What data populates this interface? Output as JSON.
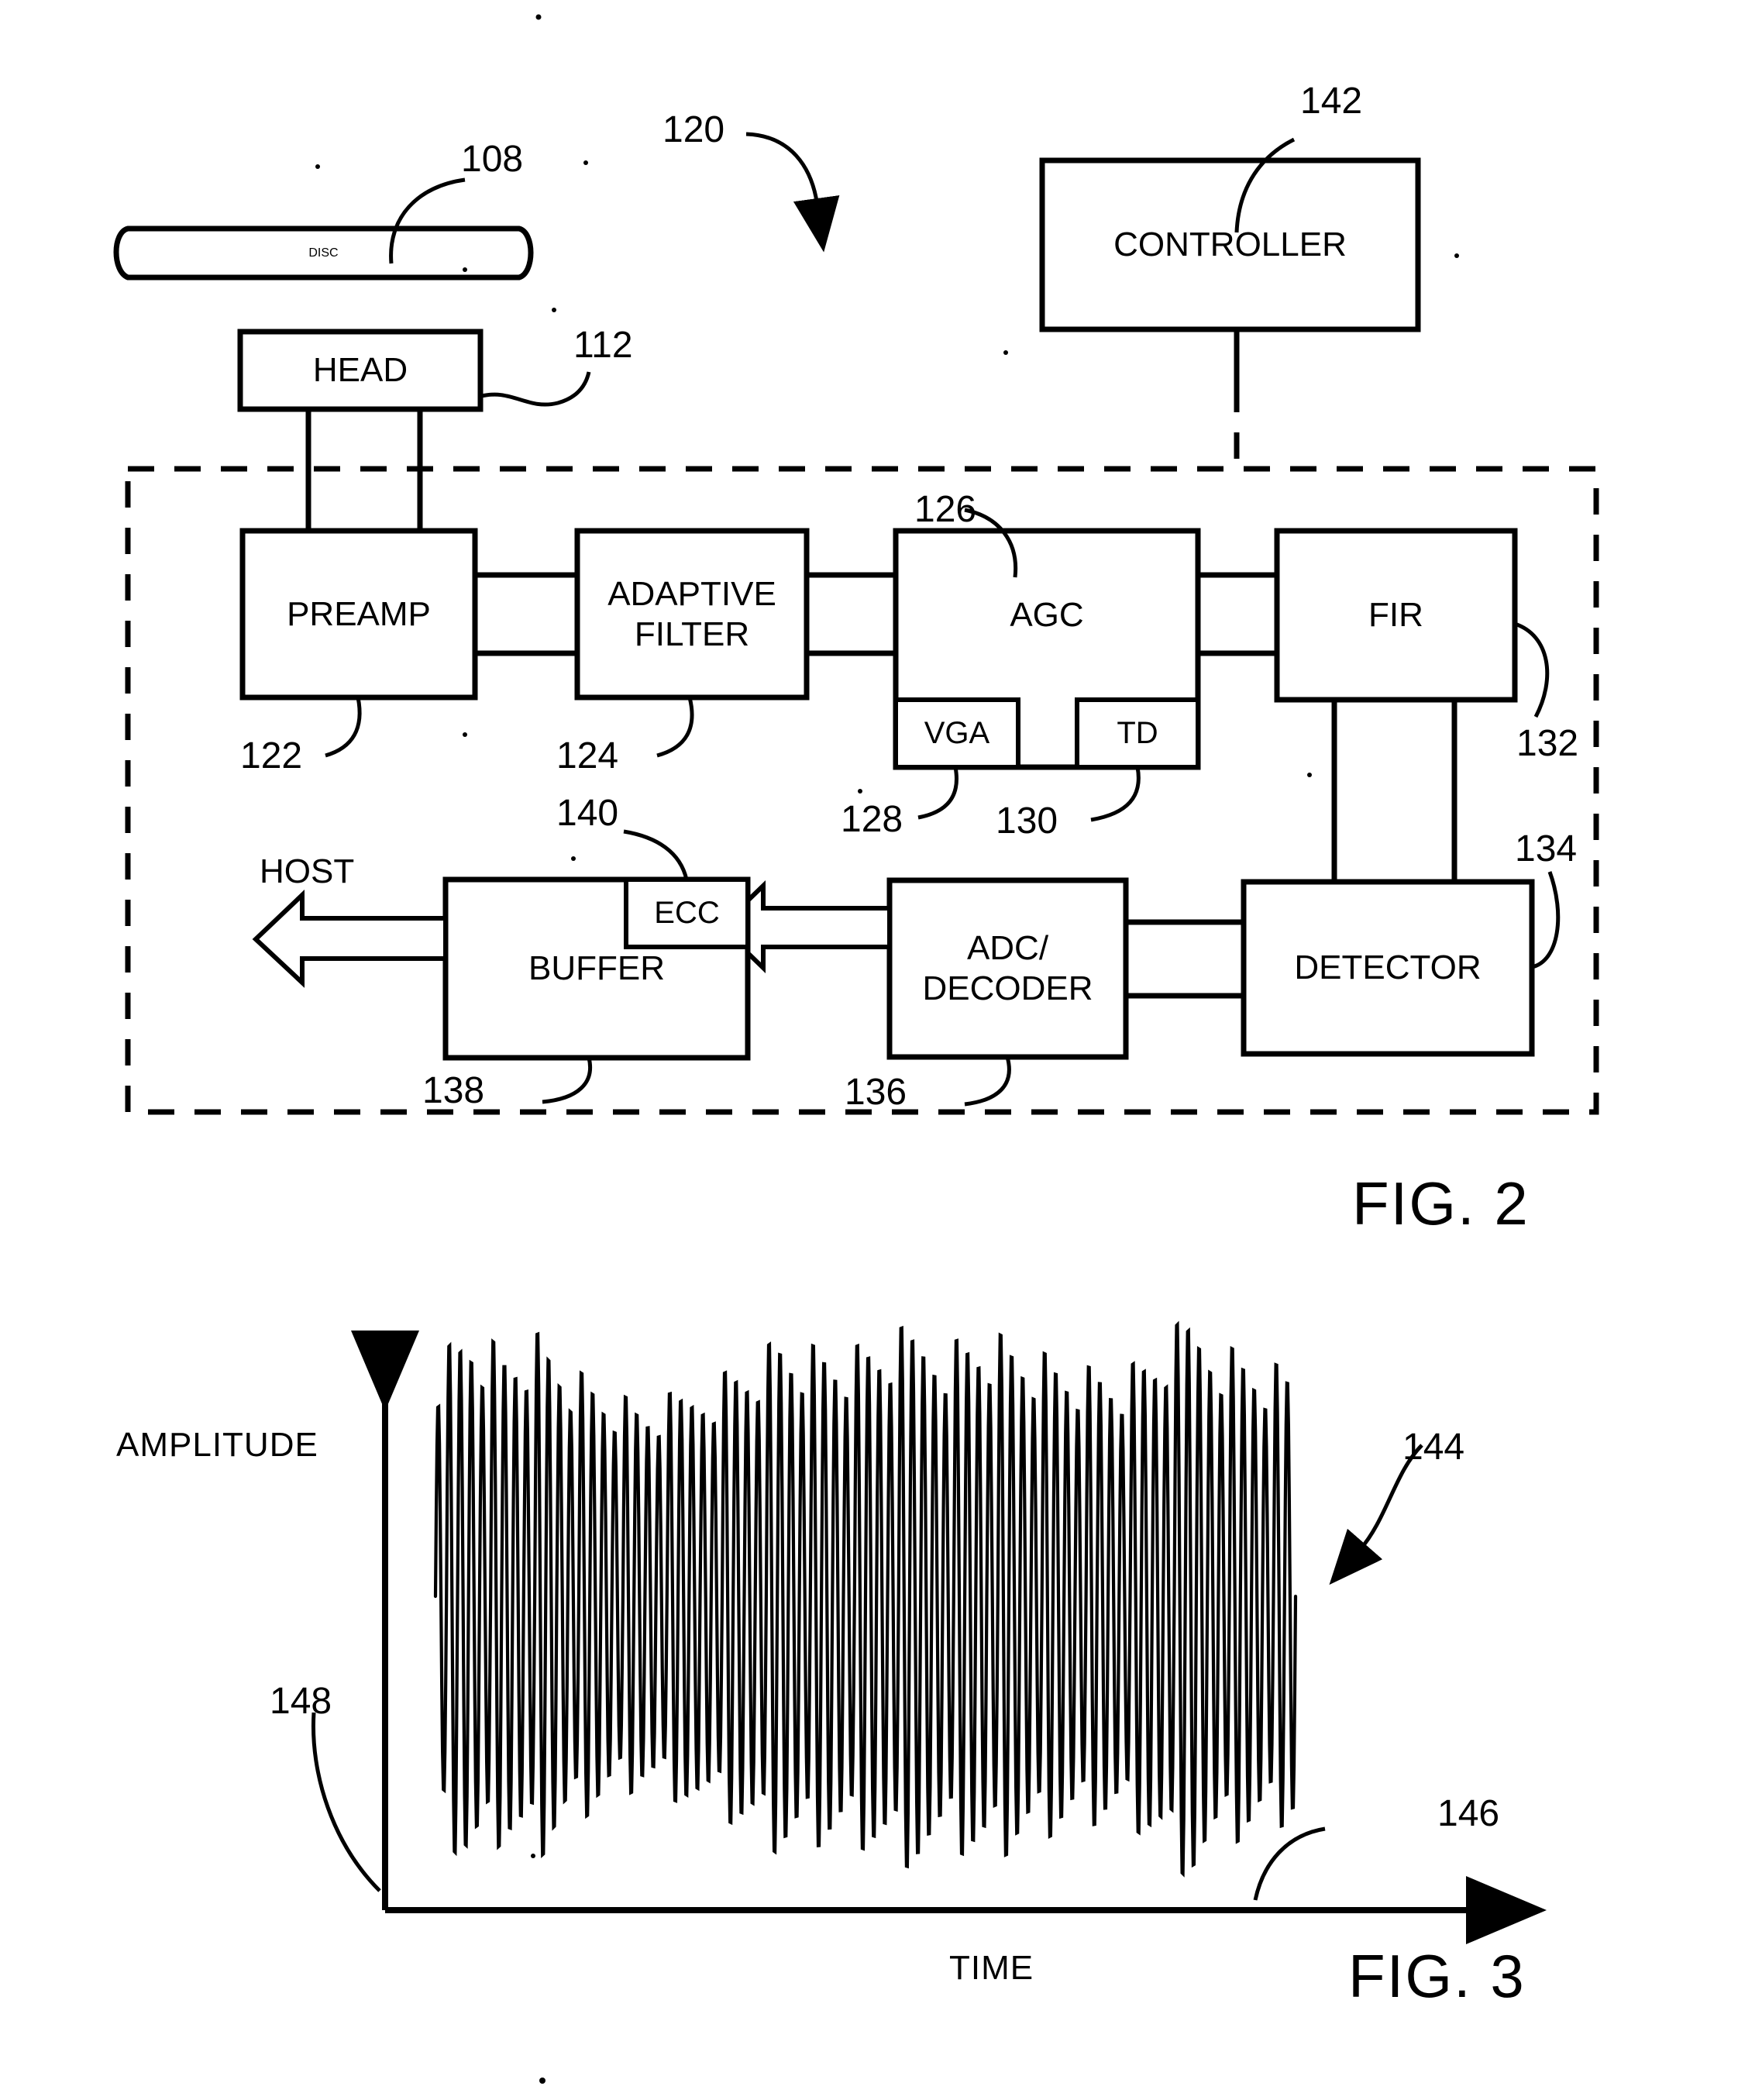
{
  "figure2": {
    "caption": "FIG. 2",
    "system_ref": "120",
    "blocks": {
      "disc": {
        "label": "DISC",
        "ref": "108"
      },
      "head": {
        "label": "HEAD",
        "ref": "112"
      },
      "preamp": {
        "label": "PREAMP",
        "ref": "122"
      },
      "filter": {
        "label_line1": "ADAPTIVE",
        "label_line2": "FILTER",
        "ref": "124"
      },
      "agc": {
        "label": "AGC",
        "ref": "126"
      },
      "vga": {
        "label": "VGA",
        "ref": "128"
      },
      "td": {
        "label": "TD",
        "ref": "130"
      },
      "fir": {
        "label": "FIR",
        "ref": "132"
      },
      "detector": {
        "label": "DETECTOR",
        "ref": "134"
      },
      "adc": {
        "label_line1": "ADC/",
        "label_line2": "DECODER",
        "ref": "136"
      },
      "buffer": {
        "label": "BUFFER",
        "ref": "138"
      },
      "ecc": {
        "label": "ECC",
        "ref": "140"
      },
      "controller": {
        "label": "CONTROLLER",
        "ref": "142"
      }
    },
    "host_label": "HOST"
  },
  "figure3": {
    "caption": "FIG. 3",
    "y_axis_label": "AMPLITUDE",
    "x_axis_label": "TIME",
    "waveform_ref": "144",
    "x_axis_ref": "146",
    "y_axis_ref": "148"
  },
  "chart_data": {
    "type": "line",
    "title": "",
    "xlabel": "TIME",
    "ylabel": "AMPLITUDE",
    "grid": false,
    "legend": null,
    "description": "Dense high-frequency read-back signal oscillating about a zero baseline with a slowly varying amplitude envelope (amplitude modulation).",
    "series": [
      {
        "name": "readback-signal",
        "envelope_x": [
          0.0,
          0.04,
          0.08,
          0.12,
          0.16,
          0.2,
          0.24,
          0.28,
          0.32,
          0.36,
          0.4,
          0.44,
          0.48,
          0.52,
          0.56,
          0.6,
          0.64,
          0.68,
          0.72,
          0.76,
          0.8,
          0.84,
          0.88,
          0.92,
          0.96,
          1.0
        ],
        "envelope_y": [
          0.86,
          0.98,
          0.88,
          0.93,
          0.8,
          0.72,
          0.66,
          0.7,
          0.78,
          0.84,
          0.92,
          0.88,
          0.86,
          0.9,
          0.94,
          0.92,
          0.96,
          0.9,
          0.84,
          0.8,
          0.78,
          0.86,
          0.98,
          0.9,
          0.84,
          0.8
        ]
      }
    ],
    "xlim": [
      0,
      1
    ],
    "ylim": [
      -1,
      1
    ]
  }
}
